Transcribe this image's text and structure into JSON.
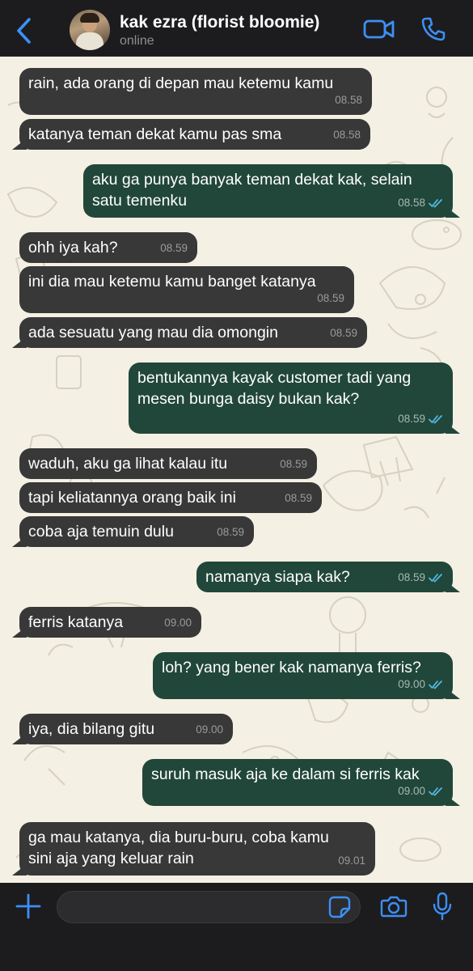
{
  "header": {
    "back_icon": "chevron-left-icon",
    "contact_name": "kak ezra (florist bloomie)",
    "status": "online",
    "video_icon": "video-camera-icon",
    "call_icon": "phone-icon",
    "accent": "#3d8ff5"
  },
  "messages": [
    {
      "dir": "in",
      "text": "rain, ada orang di depan mau ketemu kamu",
      "time": "08.58"
    },
    {
      "dir": "in",
      "text": "katanya teman dekat kamu pas sma",
      "time": "08.58"
    },
    {
      "dir": "out",
      "text": "aku ga punya banyak teman dekat kak, selain\nsatu temenku",
      "time": "08.58",
      "read": true
    },
    {
      "dir": "in",
      "text": "ohh iya kah?",
      "time": "08.59"
    },
    {
      "dir": "in",
      "text": "ini dia mau ketemu kamu banget katanya",
      "time": "08.59"
    },
    {
      "dir": "in",
      "text": "ada sesuatu yang mau dia omongin",
      "time": "08.59"
    },
    {
      "dir": "out",
      "text": "bentukannya kayak customer tadi yang\nmesen bunga daisy bukan kak?",
      "time": "08.59",
      "read": true
    },
    {
      "dir": "in",
      "text": "waduh, aku ga lihat kalau itu",
      "time": "08.59"
    },
    {
      "dir": "in",
      "text": "tapi keliatannya orang baik ini",
      "time": "08.59"
    },
    {
      "dir": "in",
      "text": "coba aja temuin dulu",
      "time": "08.59"
    },
    {
      "dir": "out",
      "text": "namanya siapa kak?",
      "time": "08.59",
      "read": true
    },
    {
      "dir": "in",
      "text": "ferris katanya",
      "time": "09.00"
    },
    {
      "dir": "out",
      "text": "loh? yang bener kak namanya ferris?",
      "time": "09.00",
      "read": true
    },
    {
      "dir": "in",
      "text": "iya, dia bilang gitu",
      "time": "09.00"
    },
    {
      "dir": "out",
      "text": "suruh masuk aja ke dalam si ferris kak",
      "time": "09.00",
      "read": true
    },
    {
      "dir": "in",
      "text": "ga mau katanya, dia buru-buru, coba kamu\nsini aja yang keluar rain",
      "time": "09.01"
    }
  ],
  "composer": {
    "plus_icon": "plus-icon",
    "sticker_icon": "sticker-icon",
    "camera_icon": "camera-icon",
    "mic_icon": "microphone-icon"
  },
  "colors": {
    "incoming_bubble": "#383838",
    "outgoing_bubble": "#21473a",
    "read_ticks": "#53bdeb",
    "wallpaper": "#f4f0e3"
  }
}
